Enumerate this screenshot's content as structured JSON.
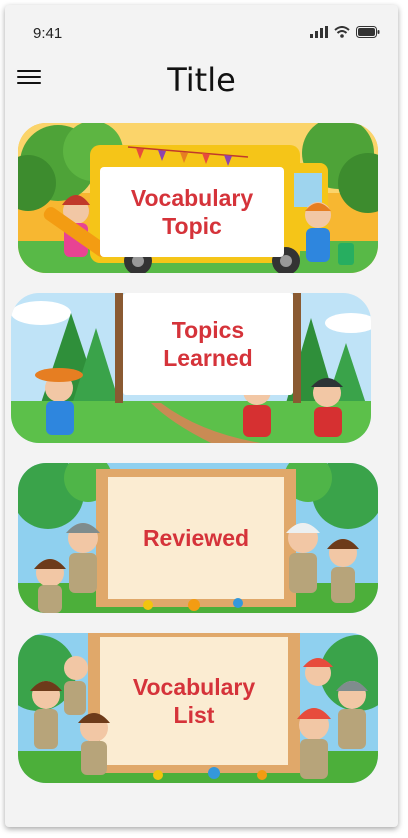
{
  "status": {
    "time": "9:41"
  },
  "header": {
    "title": "Title"
  },
  "cards": [
    {
      "label_line1": "Vocabulary",
      "label_line2": "Topic"
    },
    {
      "label_line1": "Topics",
      "label_line2": "Learned"
    },
    {
      "label_line1": "Reviewed",
      "label_line2": ""
    },
    {
      "label_line1": "Vocabulary",
      "label_line2": "List"
    }
  ],
  "colors": {
    "label": "#d5333a",
    "background": "#f3f3f3",
    "grass": "#3fa535",
    "sky": "#bfe3f7"
  },
  "icons": [
    "menu-icon",
    "signal-icon",
    "wifi-icon",
    "battery-icon"
  ]
}
